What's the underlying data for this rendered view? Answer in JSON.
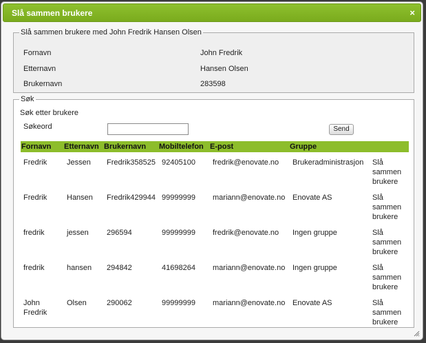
{
  "dialog": {
    "title": "Slå sammen brukere",
    "close_icon": "×"
  },
  "user_info": {
    "legend": "Slå sammen brukere med John Fredrik Hansen Olsen",
    "fields": [
      {
        "label": "Fornavn",
        "value": "John Fredrik"
      },
      {
        "label": "Etternavn",
        "value": "Hansen Olsen"
      },
      {
        "label": "Brukernavn",
        "value": "283598"
      }
    ]
  },
  "search": {
    "legend": "Søk",
    "hint": "Søk etter brukere",
    "keyword_label": "Søkeord",
    "keyword_value": "",
    "send_label": "Send"
  },
  "results": {
    "columns": [
      "Fornavn",
      "Etternavn",
      "Brukernavn",
      "Mobiltelefon",
      "E-post",
      "Gruppe"
    ],
    "rows": [
      {
        "fornavn": "Fredrik",
        "etternavn": "Jessen",
        "brukernavn": "Fredrik358525",
        "mobil": "92405100",
        "epost": "fredrik@enovate.no",
        "gruppe": "Brukeradministrasjon",
        "action": "Slå sammen brukere"
      },
      {
        "fornavn": "Fredrik",
        "etternavn": "Hansen",
        "brukernavn": "Fredrik429944",
        "mobil": "99999999",
        "epost": "mariann@enovate.no",
        "gruppe": "Enovate AS",
        "action": "Slå sammen brukere"
      },
      {
        "fornavn": "fredrik",
        "etternavn": "jessen",
        "brukernavn": "296594",
        "mobil": "99999999",
        "epost": "fredrik@enovate.no",
        "gruppe": "Ingen gruppe",
        "action": "Slå sammen brukere"
      },
      {
        "fornavn": "fredrik",
        "etternavn": "hansen",
        "brukernavn": "294842",
        "mobil": "41698264",
        "epost": "mariann@enovate.no",
        "gruppe": "Ingen gruppe",
        "action": "Slå sammen brukere"
      },
      {
        "fornavn": "John Fredrik",
        "etternavn": "Olsen",
        "brukernavn": "290062",
        "mobil": "99999999",
        "epost": "mariann@enovate.no",
        "gruppe": "Enovate AS",
        "action": "Slå sammen brukere"
      }
    ]
  },
  "colors": {
    "accent": "#8dbd2b",
    "title_bar": "#7aab1d"
  }
}
